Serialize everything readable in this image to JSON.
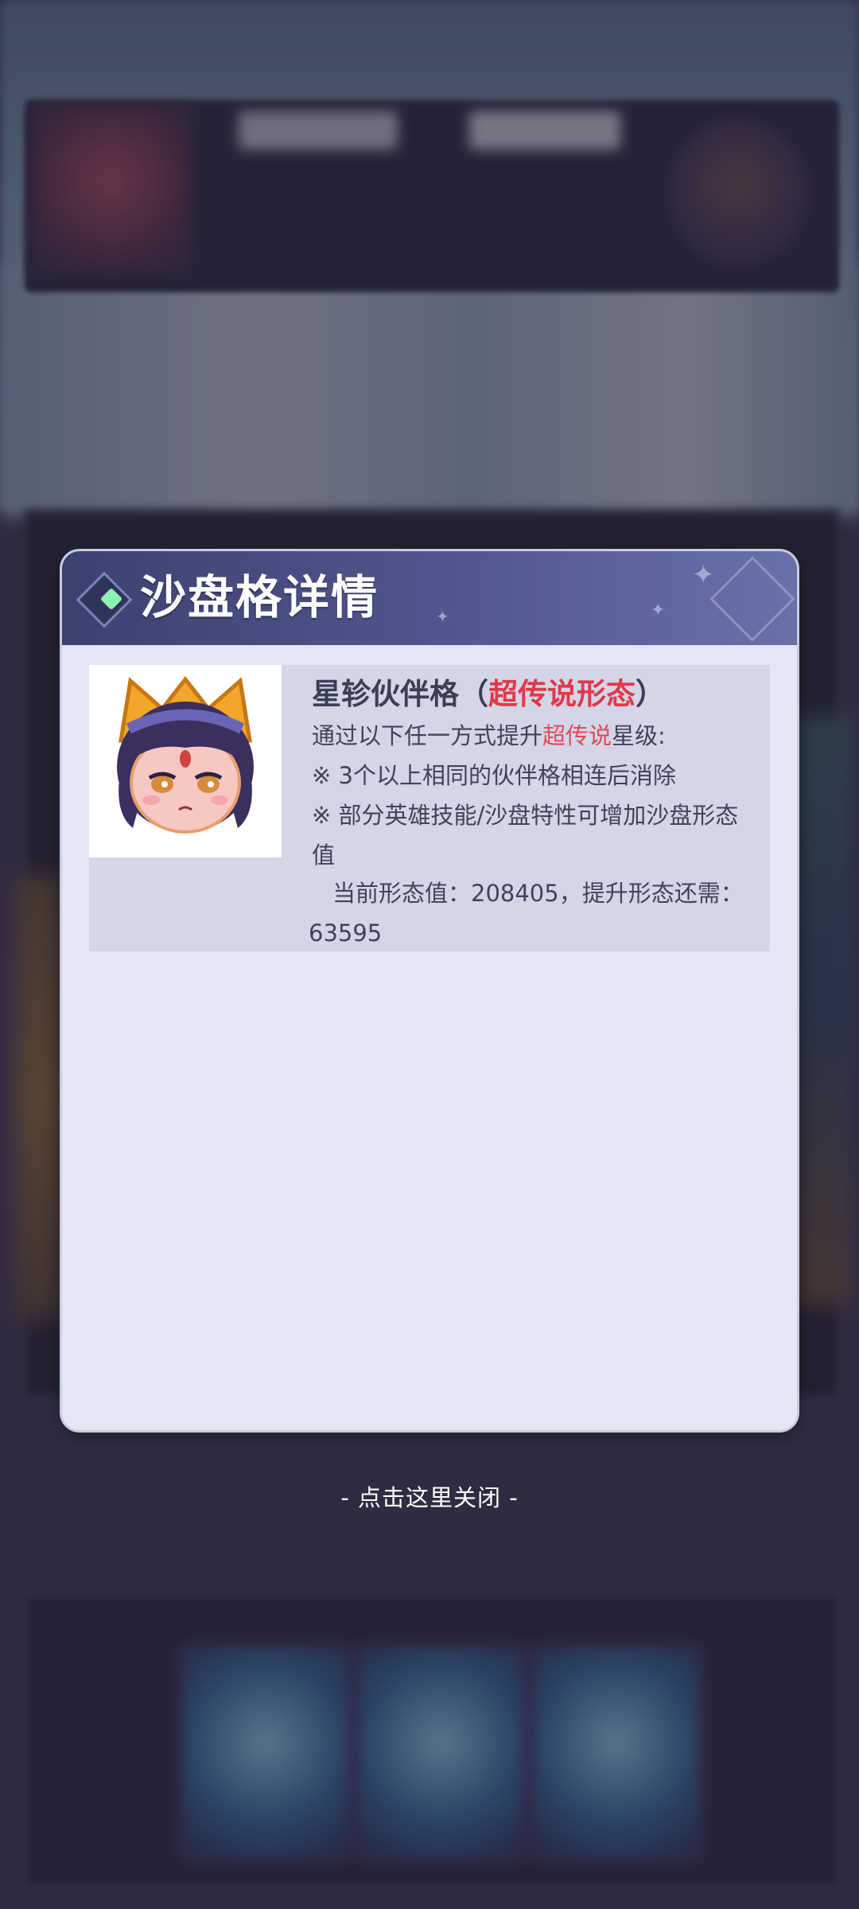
{
  "dialog": {
    "title": "沙盘格详情"
  },
  "tile": {
    "name": "星轸伙伴格",
    "paren_open": "（",
    "form": "超传说形态",
    "paren_close": "）",
    "upgrade_prefix": "通过以下任一方式提升",
    "upgrade_highlight": "超传说",
    "upgrade_suffix": "星级:",
    "method_1": "※ 3个以上相同的伙伴格相连后消除",
    "method_2": "※ 部分英雄技能/沙盘特性可增加沙盘形态值",
    "current_value_line": "当前形态值：208405，提升形态还需：63595"
  },
  "close_hint": "- 点击这里关闭 -",
  "colors": {
    "dialog_bg": "#e4e5f5",
    "header_bg": "#525790",
    "highlight": "#e0394a",
    "dot": "#8cf1b3"
  },
  "icons": {
    "portrait": "character-portrait-icon",
    "header_marker": "diamond-gem-icon"
  }
}
